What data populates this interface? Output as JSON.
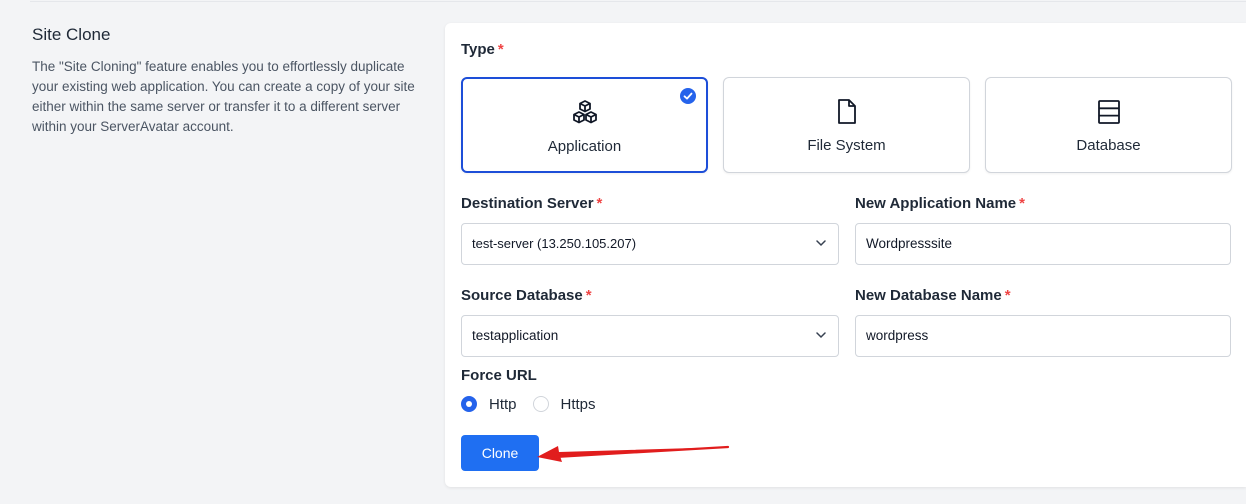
{
  "section": {
    "title": "Site Clone",
    "description": "The \"Site Cloning\" feature enables you to effortlessly duplicate your existing web application. You can create a copy of your site either within the same server or transfer it to a different server within your ServerAvatar account."
  },
  "form": {
    "type_label": "Type",
    "required_mark": "*",
    "types": [
      {
        "label": "Application",
        "icon": "cubes-icon",
        "selected": true
      },
      {
        "label": "File System",
        "icon": "file-icon",
        "selected": false
      },
      {
        "label": "Database",
        "icon": "database-icon",
        "selected": false
      }
    ],
    "destination_server": {
      "label": "Destination Server",
      "value": "test-server (13.250.105.207)"
    },
    "new_application_name": {
      "label": "New Application Name",
      "value": "Wordpresssite"
    },
    "source_database": {
      "label": "Source Database",
      "value": "testapplication"
    },
    "new_database_name": {
      "label": "New Database Name",
      "value": "wordpress"
    },
    "force_url": {
      "label": "Force URL",
      "options": [
        {
          "label": "Http",
          "selected": true
        },
        {
          "label": "Https",
          "selected": false
        }
      ]
    },
    "submit_label": "Clone"
  },
  "colors": {
    "accent": "#1f6ff2",
    "required": "#ef4444",
    "annotation_arrow": "#e11d1d"
  }
}
